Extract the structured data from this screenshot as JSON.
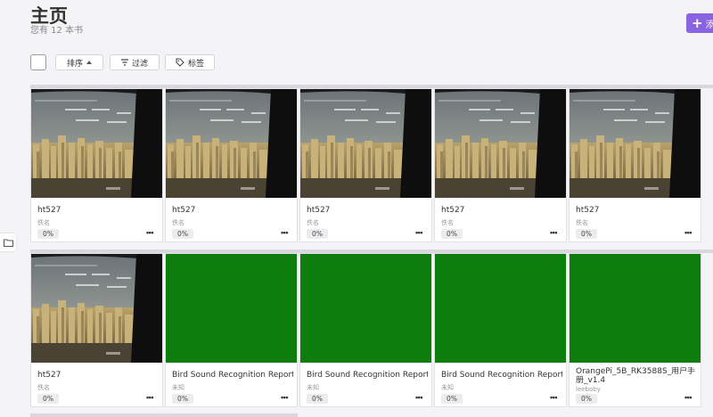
{
  "header": {
    "title": "主页",
    "subtitle": "您有 12 本书"
  },
  "toolbar": {
    "sort_label": "排序",
    "filter_label": "过滤",
    "tags_label": "标签"
  },
  "add_button": {
    "label": "添"
  },
  "books": [
    {
      "title": "ht527",
      "author": "佚名",
      "progress": "0%",
      "cover": "city-photo"
    },
    {
      "title": "ht527",
      "author": "佚名",
      "progress": "0%",
      "cover": "city-photo"
    },
    {
      "title": "ht527",
      "author": "佚名",
      "progress": "0%",
      "cover": "city-photo"
    },
    {
      "title": "ht527",
      "author": "佚名",
      "progress": "0%",
      "cover": "city-photo"
    },
    {
      "title": "ht527",
      "author": "佚名",
      "progress": "0%",
      "cover": "city-photo"
    },
    {
      "title": "ht527",
      "author": "佚名",
      "progress": "0%",
      "cover": "city-photo"
    },
    {
      "title": "Bird Sound Recognition Report",
      "author": "未知",
      "progress": "0%",
      "cover": "green"
    },
    {
      "title": "Bird Sound Recognition Report",
      "author": "未知",
      "progress": "0%",
      "cover": "green"
    },
    {
      "title": "Bird Sound Recognition Report",
      "author": "未知",
      "progress": "0%",
      "cover": "green"
    },
    {
      "title": "OrangePi_5B_RK3588S_用户手册_v1.4",
      "author": "leeboby",
      "progress": "0%",
      "cover": "green"
    }
  ],
  "colors": {
    "accent": "#8a63e0",
    "green_cover": "#0d7d0d",
    "background": "#f4f3f6"
  },
  "icons": {
    "sort": "caret-up-icon",
    "filter": "filter-icon",
    "tags": "tag-icon",
    "side": "folder-icon",
    "more": "more-dots-icon"
  }
}
